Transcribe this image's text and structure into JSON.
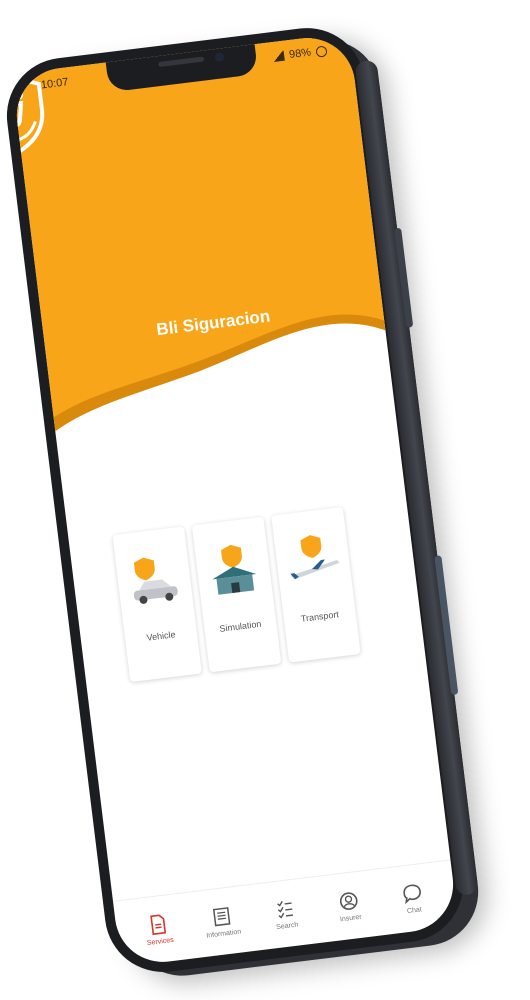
{
  "status_bar": {
    "time": "10:07",
    "battery": "98%"
  },
  "app": {
    "brand": "Bli Siguracion"
  },
  "colors": {
    "header": "#F9A51A",
    "header_wave": "#D98A0C",
    "active_tab": "#D9342B"
  },
  "cards": [
    {
      "label": "Vehicle",
      "icon": "car-icon"
    },
    {
      "label": "Simulation",
      "icon": "house-icon"
    },
    {
      "label": "Transport",
      "icon": "airplane-icon"
    }
  ],
  "tabs": [
    {
      "label": "Services",
      "icon": "document-icon",
      "active": true
    },
    {
      "label": "Information",
      "icon": "news-icon"
    },
    {
      "label": "Search",
      "icon": "checklist-icon"
    },
    {
      "label": "Insurer",
      "icon": "insurer-icon"
    },
    {
      "label": "Chat",
      "icon": "chat-bubble-icon"
    }
  ]
}
